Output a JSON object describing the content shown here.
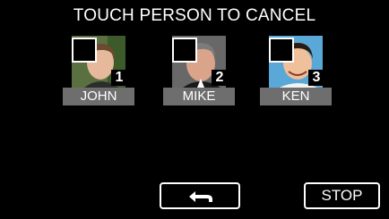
{
  "screen": {
    "title": "TOUCH PERSON TO CANCEL"
  },
  "persons": [
    {
      "number": "1",
      "name": "JOHN"
    },
    {
      "number": "2",
      "name": "MIKE"
    },
    {
      "number": "3",
      "name": "KEN"
    }
  ],
  "buttons": {
    "back_icon": "return-arrow-icon",
    "stop_label": "STOP"
  },
  "colors": {
    "background": "#000000",
    "name_bar": "#6e6e6e",
    "text": "#ffffff"
  }
}
